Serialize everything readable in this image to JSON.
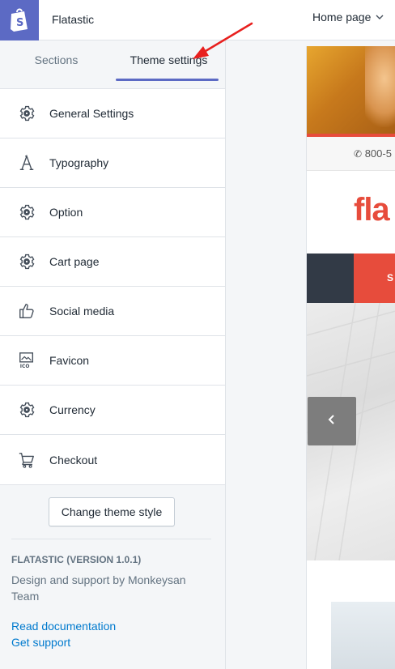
{
  "store": {
    "name": "Flatastic"
  },
  "tabs": [
    {
      "label": "Sections",
      "active": false
    },
    {
      "label": "Theme settings",
      "active": true
    }
  ],
  "menu": [
    {
      "label": "General Settings",
      "icon": "gear-icon"
    },
    {
      "label": "Typography",
      "icon": "typography-icon"
    },
    {
      "label": "Option",
      "icon": "gear-icon"
    },
    {
      "label": "Cart page",
      "icon": "gear-icon"
    },
    {
      "label": "Social media",
      "icon": "thumbs-up-icon"
    },
    {
      "label": "Favicon",
      "icon": "favicon-icon"
    },
    {
      "label": "Currency",
      "icon": "gear-icon"
    },
    {
      "label": "Checkout",
      "icon": "cart-icon"
    }
  ],
  "footer": {
    "button": "Change theme style",
    "version": "FLATASTIC (VERSION 1.0.1)",
    "credits": "Design and support by Monkeysan Team",
    "docs_link": "Read documentation",
    "support_link": "Get support"
  },
  "preview": {
    "page_select": "Home page",
    "phone": "800-5",
    "brand": "fla",
    "nav_letter": "S"
  },
  "colors": {
    "accent": "#5c6ac4",
    "link": "#007ace",
    "annotation_arrow": "#e8201e",
    "brand_red": "#e74c3c"
  }
}
